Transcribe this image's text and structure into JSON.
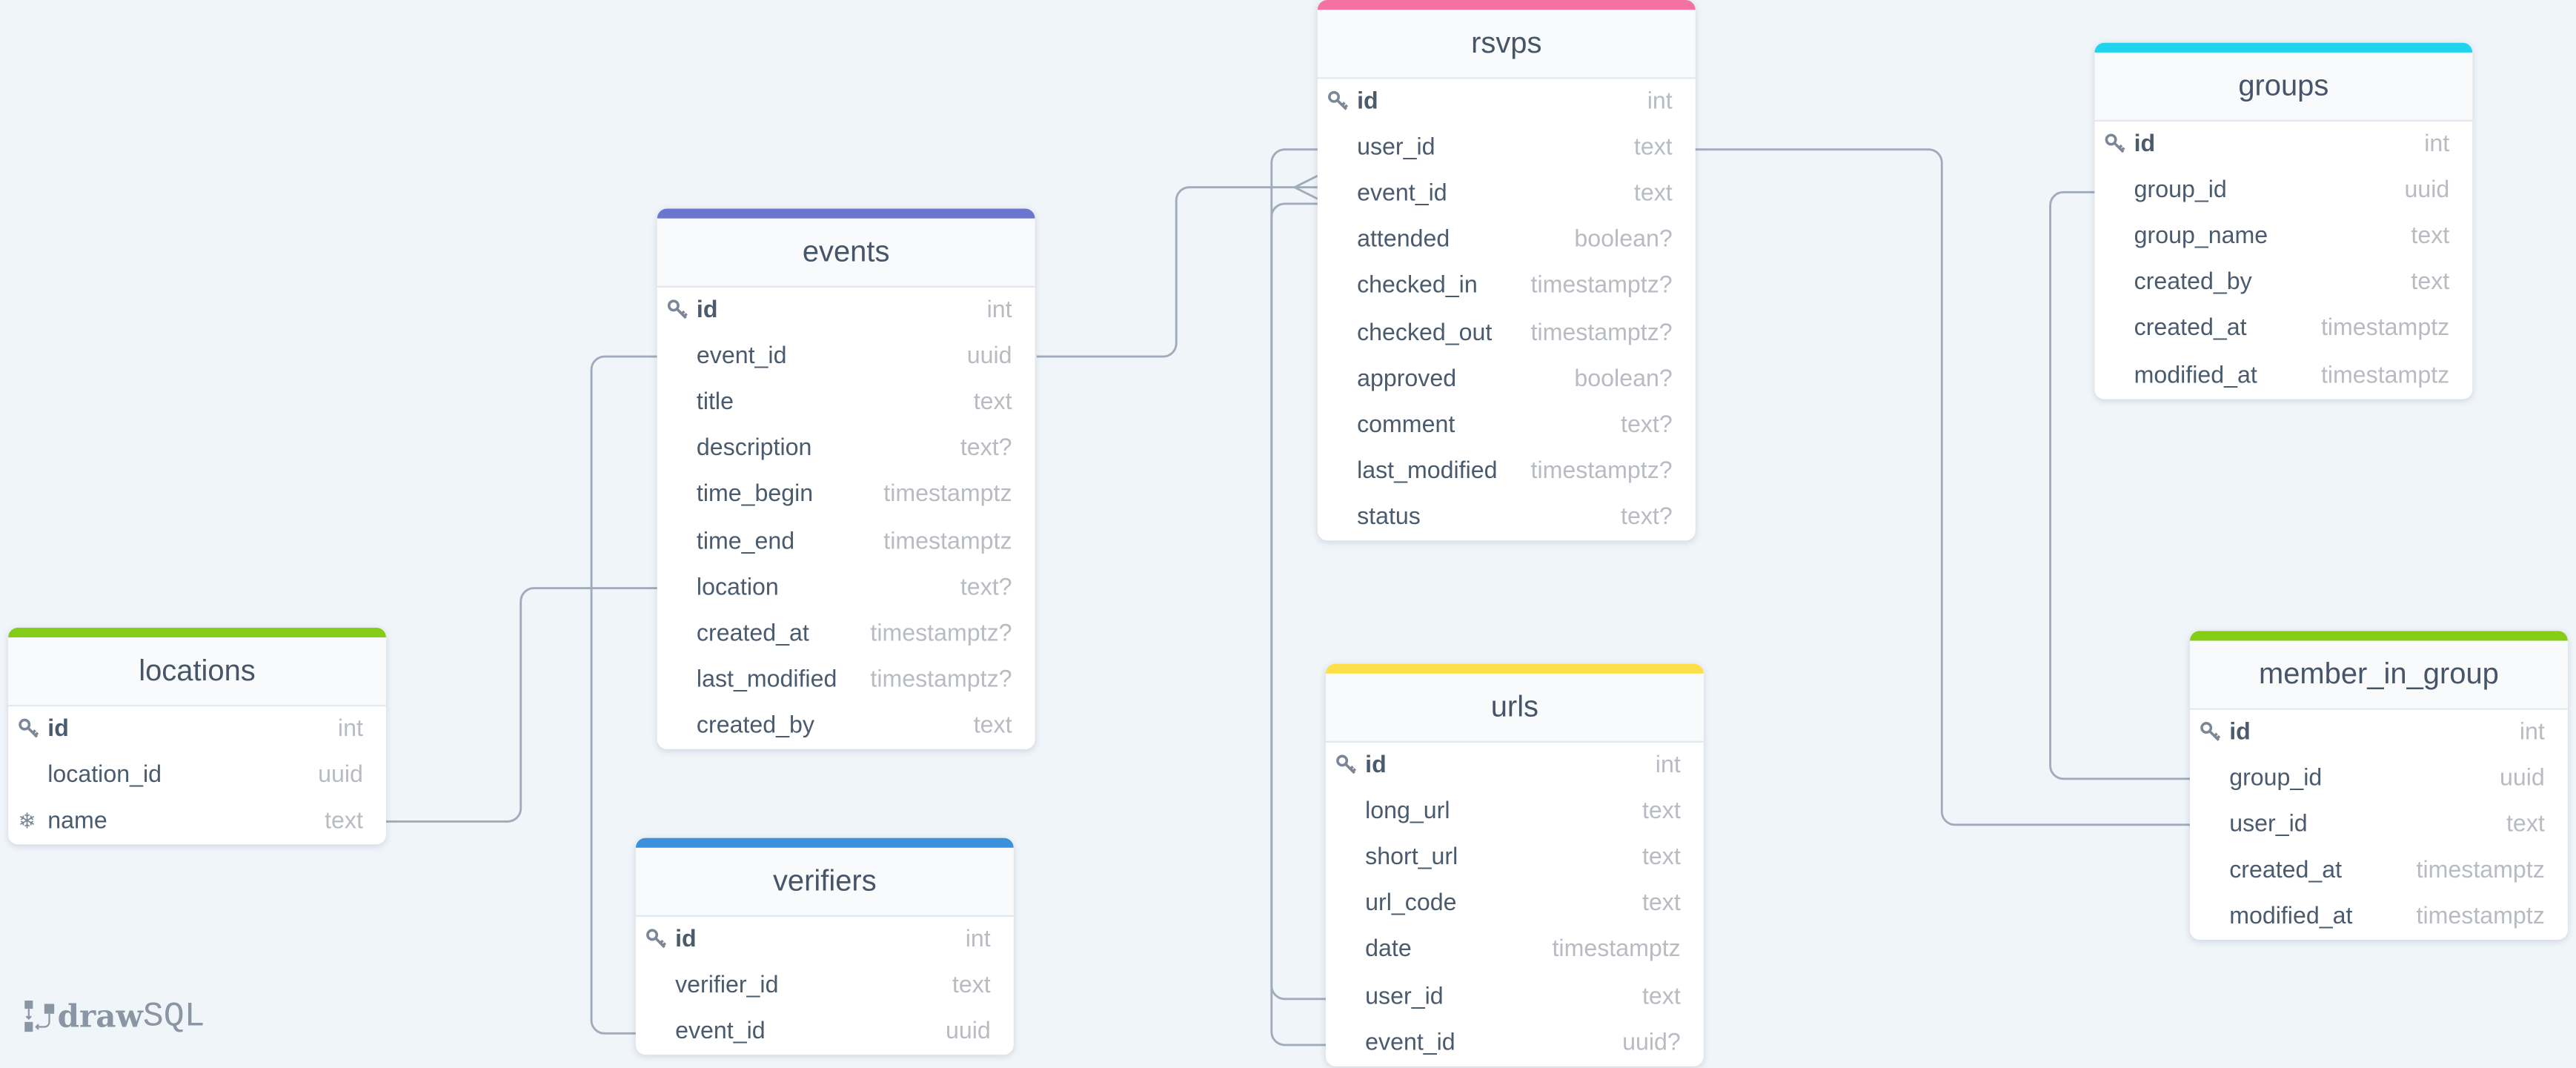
{
  "app": {
    "logo_bold": "draw",
    "logo_light": "SQL"
  },
  "colors": {
    "background": "#f0f5f9",
    "line": "#a0acbb"
  },
  "tables": {
    "rsvps": {
      "name": "rsvps",
      "color": "#f472a0",
      "columns": [
        {
          "name": "id",
          "type": "int",
          "pk": true
        },
        {
          "name": "user_id",
          "type": "text"
        },
        {
          "name": "event_id",
          "type": "text"
        },
        {
          "name": "attended",
          "type": "boolean?"
        },
        {
          "name": "checked_in",
          "type": "timestamptz?"
        },
        {
          "name": "checked_out",
          "type": "timestamptz?"
        },
        {
          "name": "approved",
          "type": "boolean?"
        },
        {
          "name": "comment",
          "type": "text?"
        },
        {
          "name": "last_modified",
          "type": "timestamptz?"
        },
        {
          "name": "status",
          "type": "text?"
        }
      ]
    },
    "groups": {
      "name": "groups",
      "color": "#22d3ee",
      "columns": [
        {
          "name": "id",
          "type": "int",
          "pk": true
        },
        {
          "name": "group_id",
          "type": "uuid"
        },
        {
          "name": "group_name",
          "type": "text"
        },
        {
          "name": "created_by",
          "type": "text"
        },
        {
          "name": "created_at",
          "type": "timestamptz"
        },
        {
          "name": "modified_at",
          "type": "timestamptz"
        }
      ]
    },
    "events": {
      "name": "events",
      "color": "#6b77cf",
      "columns": [
        {
          "name": "id",
          "type": "int",
          "pk": true
        },
        {
          "name": "event_id",
          "type": "uuid"
        },
        {
          "name": "title",
          "type": "text"
        },
        {
          "name": "description",
          "type": "text?"
        },
        {
          "name": "time_begin",
          "type": "timestamptz"
        },
        {
          "name": "time_end",
          "type": "timestamptz"
        },
        {
          "name": "location",
          "type": "text?"
        },
        {
          "name": "created_at",
          "type": "timestamptz?"
        },
        {
          "name": "last_modified",
          "type": "timestamptz?"
        },
        {
          "name": "created_by",
          "type": "text"
        }
      ]
    },
    "locations": {
      "name": "locations",
      "color": "#84cc16",
      "columns": [
        {
          "name": "id",
          "type": "int",
          "pk": true
        },
        {
          "name": "location_id",
          "type": "uuid"
        },
        {
          "name": "name",
          "type": "text",
          "unique": true
        }
      ]
    },
    "verifiers": {
      "name": "verifiers",
      "color": "#3b8fdb",
      "columns": [
        {
          "name": "id",
          "type": "int",
          "pk": true
        },
        {
          "name": "verifier_id",
          "type": "text"
        },
        {
          "name": "event_id",
          "type": "uuid"
        }
      ]
    },
    "urls": {
      "name": "urls",
      "color": "#fde047",
      "columns": [
        {
          "name": "id",
          "type": "int",
          "pk": true
        },
        {
          "name": "long_url",
          "type": "text"
        },
        {
          "name": "short_url",
          "type": "text"
        },
        {
          "name": "url_code",
          "type": "text"
        },
        {
          "name": "date",
          "type": "timestamptz"
        },
        {
          "name": "user_id",
          "type": "text"
        },
        {
          "name": "event_id",
          "type": "uuid?"
        }
      ]
    },
    "member_in_group": {
      "name": "member_in_group",
      "color": "#84cc16",
      "columns": [
        {
          "name": "id",
          "type": "int",
          "pk": true
        },
        {
          "name": "group_id",
          "type": "uuid"
        },
        {
          "name": "user_id",
          "type": "text"
        },
        {
          "name": "created_at",
          "type": "timestamptz"
        },
        {
          "name": "modified_at",
          "type": "timestamptz"
        }
      ]
    }
  },
  "relations": [
    {
      "from": "events.event_id",
      "to": "rsvps.event_id",
      "type": "one-to-many"
    },
    {
      "from": "events.event_id",
      "to": "verifiers.event_id",
      "type": "one-to-one"
    },
    {
      "from": "locations.name",
      "to": "events.location",
      "type": "one-to-one"
    },
    {
      "from": "rsvps.user_id",
      "to": "urls.user_id",
      "type": "one-to-one"
    },
    {
      "from": "rsvps.event_id",
      "to": "urls.event_id",
      "type": "one-to-one"
    },
    {
      "from": "rsvps.user_id",
      "to": "member_in_group.user_id",
      "type": "one-to-one"
    },
    {
      "from": "groups.group_id",
      "to": "member_in_group.group_id",
      "type": "one-to-one"
    }
  ]
}
